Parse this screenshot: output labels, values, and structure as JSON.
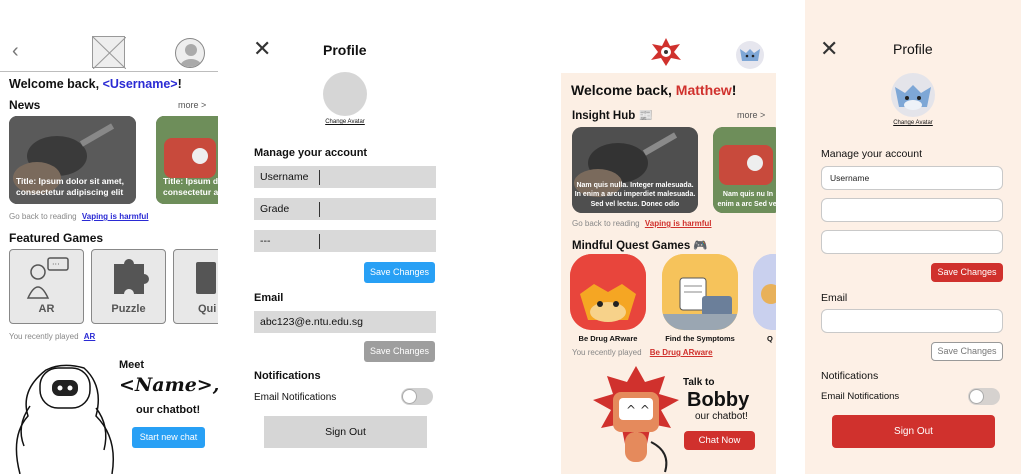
{
  "wireframe_home": {
    "welcome_prefix": "Welcome back, ",
    "username": "<Username>",
    "welcome_suffix": "!",
    "news_title": "News",
    "news_more": "more >",
    "news_card_1": "Title: Ipsum dolor sit amet, consectetur adipiscing elit",
    "news_card_2": "Title: Ipsum d consectetur a",
    "go_back_text": "Go back to reading",
    "go_back_link": "Vaping is harmful",
    "featured_title": "Featured Games",
    "game_1": "AR",
    "game_2": "Puzzle",
    "game_3": "Qui",
    "recent_text": "You recently played",
    "recent_link": "AR",
    "meet": "Meet",
    "name": "<Name>",
    "comma": ",",
    "our_chatbot": "our chatbot!",
    "start_chat": "Start new chat"
  },
  "wireframe_profile": {
    "title": "Profile",
    "change_avatar": "Change Avatar",
    "manage_title": "Manage your account",
    "field_username": "Username",
    "field_grade": "Grade",
    "field_other": "---",
    "save_changes_1": "Save Changes",
    "email_title": "Email",
    "email_value": "abc123@e.ntu.edu.sg",
    "save_changes_2": "Save Changes",
    "notifications_title": "Notifications",
    "email_notifications": "Email Notifications",
    "sign_out": "Sign Out"
  },
  "hifi_home": {
    "welcome_prefix": "Welcome back, ",
    "username": "Matthew",
    "welcome_suffix": "!",
    "insight_title": "Insight Hub",
    "insight_emoji": "📰",
    "more": "more >",
    "news_card_1": "Nam quis nulla. Integer malesuada. In enim a arcu imperdiet malesuada. Sed vel lectus. Donec odio",
    "news_card_2": "Nam quis nu In enim a arc Sed vel",
    "go_back_text": "Go back to reading",
    "go_back_link": "Vaping is harmful",
    "quest_title": "Mindful Quest Games",
    "quest_emoji": "🎮",
    "game_1": "Be Drug ARware",
    "game_2": "Find the Symptoms",
    "game_3": "Q",
    "recent_text": "You recently played",
    "recent_link": "Be Drug ARware",
    "talk_to": "Talk to",
    "bot_name": "Bobby",
    "our_chatbot": "our chatbot!",
    "chat_now": "Chat Now"
  },
  "hifi_profile": {
    "title": "Profile",
    "change_avatar": "Change Avatar",
    "manage_title": "Manage your account",
    "field_username": "Username",
    "field_2": "",
    "field_3": "",
    "save_changes_1": "Save Changes",
    "email_title": "Email",
    "email_value": "",
    "save_changes_2": "Save Changes",
    "notifications_title": "Notifications",
    "email_notifications": "Email Notifications",
    "sign_out": "Sign Out"
  },
  "colors": {
    "accent_blue": "#28a0f5",
    "accent_red": "#d0312d",
    "warm_bg": "#fcefe4"
  }
}
